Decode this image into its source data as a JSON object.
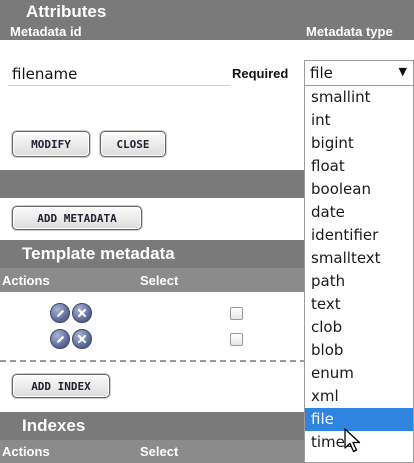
{
  "attributes": {
    "title": "Attributes",
    "metadata_id_label": "Metadata id",
    "metadata_id_value": "filename",
    "required_label": "Required",
    "metadata_type_label": "Metadata type"
  },
  "buttons": {
    "modify": "MODIFY",
    "close": "CLOSE",
    "add_metadata": "ADD METADATA",
    "add_index": "ADD INDEX"
  },
  "template_metadata": {
    "title": "Template metadata",
    "col_actions": "Actions",
    "col_select": "Select",
    "rows": [
      {
        "edit_icon": "pencil-icon",
        "delete_icon": "x-icon"
      },
      {
        "edit_icon": "pencil-icon",
        "delete_icon": "x-icon"
      }
    ]
  },
  "indexes": {
    "title": "Indexes",
    "col_actions": "Actions",
    "col_select": "Select"
  },
  "metadata_type_select": {
    "selected": "file",
    "options": [
      "smallint",
      "int",
      "bigint",
      "float",
      "boolean",
      "date",
      "identifier",
      "smalltext",
      "path",
      "text",
      "clob",
      "blob",
      "enum",
      "xml",
      "file",
      "timec"
    ],
    "highlighted": "file"
  },
  "colors": {
    "header_bg": "#7a7a7a",
    "selected_option_bg": "#2f84e0"
  }
}
